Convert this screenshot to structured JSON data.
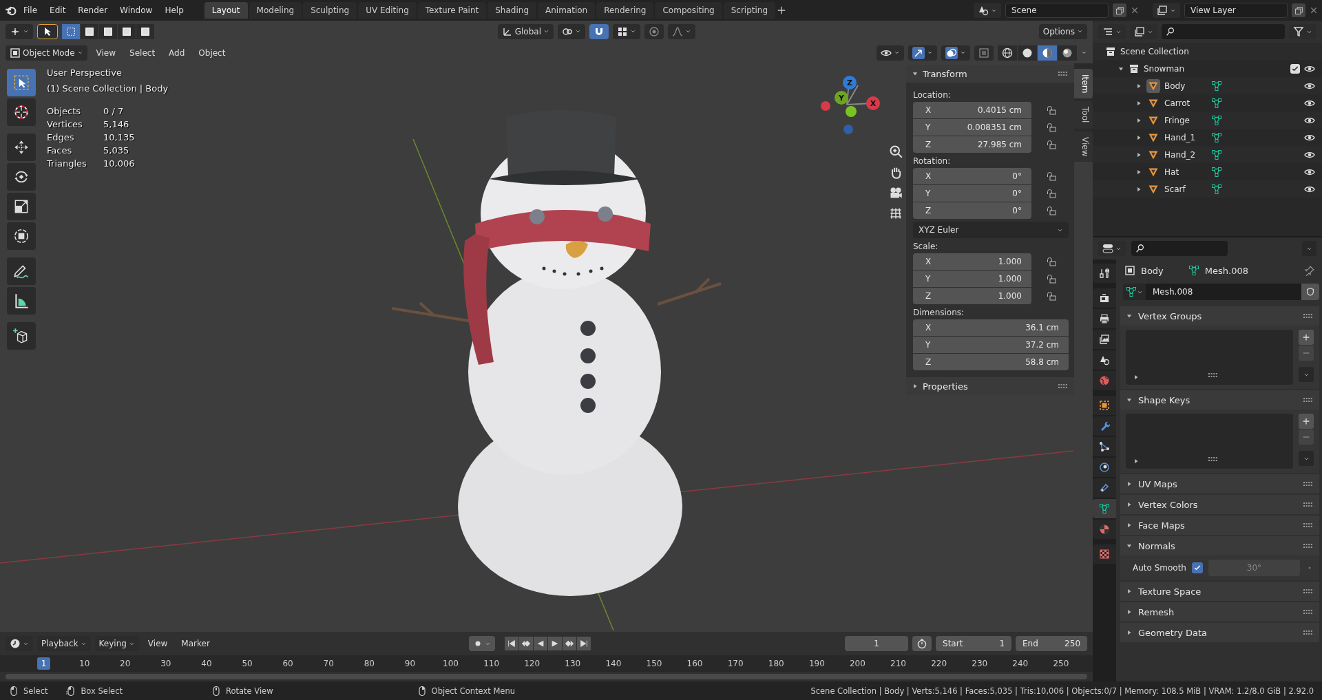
{
  "menu": [
    "File",
    "Edit",
    "Render",
    "Window",
    "Help"
  ],
  "workspaces": [
    {
      "label": "Layout",
      "selected": true
    },
    {
      "label": "Modeling",
      "selected": false
    },
    {
      "label": "Sculpting",
      "selected": false
    },
    {
      "label": "UV Editing",
      "selected": false
    },
    {
      "label": "Texture Paint",
      "selected": false
    },
    {
      "label": "Shading",
      "selected": false
    },
    {
      "label": "Animation",
      "selected": false
    },
    {
      "label": "Rendering",
      "selected": false
    },
    {
      "label": "Compositing",
      "selected": false
    },
    {
      "label": "Scripting",
      "selected": false
    }
  ],
  "scene": "Scene",
  "view_layer": "View Layer",
  "viewport": {
    "orientation": "Global",
    "options": "Options",
    "mode": "Object Mode",
    "menus": [
      "View",
      "Select",
      "Add",
      "Object"
    ],
    "overlay": {
      "view_name": "User Perspective",
      "context": "(1) Scene Collection | Body",
      "stats": [
        {
          "label": "Objects",
          "value": "0 / 7"
        },
        {
          "label": "Vertices",
          "value": "5,146"
        },
        {
          "label": "Edges",
          "value": "10,135"
        },
        {
          "label": "Faces",
          "value": "5,035"
        },
        {
          "label": "Triangles",
          "value": "10,006"
        }
      ]
    },
    "tools": [
      {
        "kind": "select",
        "selected": true
      },
      {
        "kind": "cursor",
        "selected": false
      },
      {
        "kind": "move",
        "selected": false
      },
      {
        "kind": "rotate",
        "selected": false
      },
      {
        "kind": "scale",
        "selected": false
      },
      {
        "kind": "transform",
        "selected": false
      },
      {
        "kind": "annotate",
        "selected": false
      },
      {
        "kind": "measure",
        "selected": false
      },
      {
        "kind": "add-cube",
        "selected": false
      }
    ],
    "gizmo_axes": [
      {
        "label": "Z",
        "color": "#2f7cd6"
      },
      {
        "label": "Y",
        "color": "#6fa322"
      },
      {
        "label": "X",
        "color": "#d93a49"
      }
    ],
    "shading_modes": [
      {
        "kind": "wireframe",
        "selected": false
      },
      {
        "kind": "solid",
        "selected": false
      },
      {
        "kind": "material",
        "selected": true
      },
      {
        "kind": "rendered",
        "selected": false
      }
    ],
    "sidebar_tabs": [
      {
        "label": "Item",
        "selected": true
      },
      {
        "label": "Tool",
        "selected": false
      },
      {
        "label": "View",
        "selected": false
      }
    ],
    "transform": {
      "title": "Transform",
      "expanded": true,
      "groups": [
        {
          "label": "Location:",
          "locks": true,
          "fields": [
            {
              "axis": "X",
              "value": "0.4015 cm"
            },
            {
              "axis": "Y",
              "value": "0.008351 cm"
            },
            {
              "axis": "Z",
              "value": "27.985 cm"
            }
          ]
        },
        {
          "label": "Rotation:",
          "locks": true,
          "fields": [
            {
              "axis": "X",
              "value": "0°"
            },
            {
              "axis": "Y",
              "value": "0°"
            },
            {
              "axis": "Z",
              "value": "0°"
            }
          ],
          "mode": "XYZ Euler"
        },
        {
          "label": "Scale:",
          "locks": true,
          "fields": [
            {
              "axis": "X",
              "value": "1.000"
            },
            {
              "axis": "Y",
              "value": "1.000"
            },
            {
              "axis": "Z",
              "value": "1.000"
            }
          ]
        },
        {
          "label": "Dimensions:",
          "locks": false,
          "fields": [
            {
              "axis": "X",
              "value": "36.1 cm"
            },
            {
              "axis": "Y",
              "value": "37.2 cm"
            },
            {
              "axis": "Z",
              "value": "58.8 cm"
            }
          ]
        }
      ]
    },
    "properties_panel": {
      "title": "Properties",
      "expanded": false
    }
  },
  "outliner": {
    "root": "Scene Collection",
    "tree": [
      {
        "name": "Snowman",
        "expanded": true,
        "checked": true,
        "children": [
          {
            "name": "Body",
            "selected": true,
            "expanded": false
          },
          {
            "name": "Carrot",
            "selected": false,
            "expanded": false
          },
          {
            "name": "Fringe",
            "selected": false,
            "expanded": false
          },
          {
            "name": "Hand_1",
            "selected": false,
            "expanded": false
          },
          {
            "name": "Hand_2",
            "selected": false,
            "expanded": false
          },
          {
            "name": "Hat",
            "selected": false,
            "expanded": false
          },
          {
            "name": "Scarf",
            "selected": false,
            "expanded": false
          }
        ]
      }
    ]
  },
  "properties": {
    "tabs": [
      {
        "kind": "tool",
        "selected": false
      },
      {
        "kind": "render",
        "selected": false
      },
      {
        "kind": "output",
        "selected": false
      },
      {
        "kind": "view-layer",
        "selected": false
      },
      {
        "kind": "scene",
        "selected": false
      },
      {
        "kind": "world",
        "selected": false
      },
      {
        "kind": "object",
        "selected": false
      },
      {
        "kind": "modifier",
        "selected": false
      },
      {
        "kind": "particles",
        "selected": false
      },
      {
        "kind": "physics",
        "selected": false
      },
      {
        "kind": "constraints",
        "selected": false
      },
      {
        "kind": "data",
        "selected": true
      },
      {
        "kind": "material",
        "selected": false
      },
      {
        "kind": "texture",
        "selected": false
      }
    ],
    "object": "Body",
    "data": "Mesh.008",
    "datablock": "Mesh.008",
    "panels": [
      {
        "title": "Vertex Groups",
        "expanded": true,
        "kind": "list"
      },
      {
        "title": "Shape Keys",
        "expanded": true,
        "kind": "list"
      },
      {
        "title": "UV Maps",
        "expanded": false
      },
      {
        "title": "Vertex Colors",
        "expanded": false
      },
      {
        "title": "Face Maps",
        "expanded": false
      },
      {
        "title": "Normals",
        "expanded": true,
        "kind": "normals",
        "auto_smooth": {
          "label": "Auto Smooth",
          "checked": true,
          "angle": "30°"
        }
      },
      {
        "title": "Texture Space",
        "expanded": false
      },
      {
        "title": "Remesh",
        "expanded": false
      },
      {
        "title": "Geometry Data",
        "expanded": false
      }
    ]
  },
  "timeline": {
    "menus": [
      {
        "label": "Playback",
        "dropdown": true
      },
      {
        "label": "Keying",
        "dropdown": true
      },
      {
        "label": "View",
        "dropdown": false
      },
      {
        "label": "Marker",
        "dropdown": false
      }
    ],
    "current_frame": "1",
    "start_label": "Start",
    "start": "1",
    "end_label": "End",
    "end": "250",
    "ruler": [
      {
        "label": "1",
        "selected": true
      },
      {
        "label": "10",
        "selected": false
      },
      {
        "label": "20",
        "selected": false
      },
      {
        "label": "30",
        "selected": false
      },
      {
        "label": "40",
        "selected": false
      },
      {
        "label": "50",
        "selected": false
      },
      {
        "label": "60",
        "selected": false
      },
      {
        "label": "70",
        "selected": false
      },
      {
        "label": "80",
        "selected": false
      },
      {
        "label": "90",
        "selected": false
      },
      {
        "label": "100",
        "selected": false
      },
      {
        "label": "110",
        "selected": false
      },
      {
        "label": "120",
        "selected": false
      },
      {
        "label": "130",
        "selected": false
      },
      {
        "label": "140",
        "selected": false
      },
      {
        "label": "150",
        "selected": false
      },
      {
        "label": "160",
        "selected": false
      },
      {
        "label": "170",
        "selected": false
      },
      {
        "label": "180",
        "selected": false
      },
      {
        "label": "190",
        "selected": false
      },
      {
        "label": "200",
        "selected": false
      },
      {
        "label": "210",
        "selected": false
      },
      {
        "label": "220",
        "selected": false
      },
      {
        "label": "230",
        "selected": false
      },
      {
        "label": "240",
        "selected": false
      },
      {
        "label": "250",
        "selected": false
      }
    ]
  },
  "status": {
    "hints": [
      {
        "kind": "mouse-left",
        "label": "Select"
      },
      {
        "kind": "mouse-drag",
        "label": "Box Select"
      },
      {
        "kind": "mouse-middle",
        "label": "Rotate View"
      },
      {
        "kind": "mouse-right",
        "label": "Object Context Menu"
      }
    ],
    "info": "Scene Collection | Body | Verts:5,146 | Faces:5,035 | Tris:10,006 | Objects:0/7 | Memory: 108.5 MiB | VRAM: 1.2/8.0 GiB | 2.92.0"
  }
}
